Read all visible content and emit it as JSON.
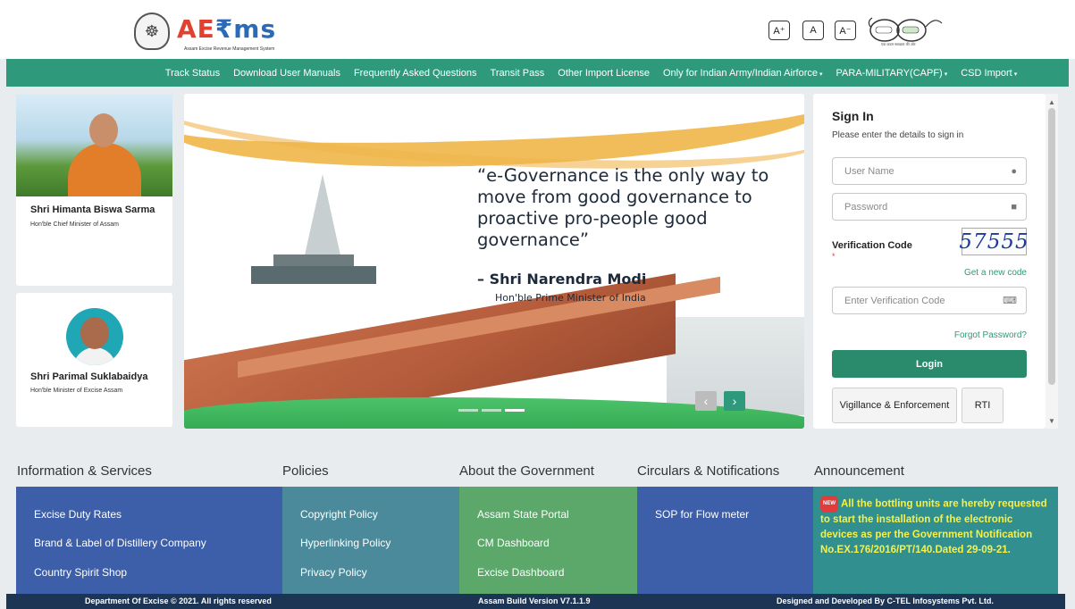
{
  "header": {
    "logo_main": "AE",
    "logo_accent": "₹ms",
    "logo_sub": "Assam Excise Revenue Management System",
    "font_buttons": [
      "A⁺",
      "A",
      "A⁻"
    ],
    "swachh_text": "एक कदम स्वच्छता की ओर"
  },
  "nav": {
    "items": [
      {
        "label": "Track Status"
      },
      {
        "label": "Download User Manuals"
      },
      {
        "label": "Frequently Asked Questions"
      },
      {
        "label": "Transit Pass"
      },
      {
        "label": "Other Import License"
      },
      {
        "label": "Only for Indian Army/Indian Airforce",
        "dropdown": true
      },
      {
        "label": "PARA-MILITARY(CAPF)",
        "dropdown": true
      },
      {
        "label": "CSD Import",
        "dropdown": true
      }
    ],
    "caret": "▾"
  },
  "profiles": [
    {
      "name": "Shri Himanta Biswa Sarma",
      "role": "Hon'ble Chief Minister of Assam"
    },
    {
      "name": "Shri Parimal Suklabaidya",
      "role": "Hon'ble Minister of Excise Assam"
    }
  ],
  "banner": {
    "quote": "“e-Governance is the only way to move from good governance to proactive pro-people good governance”",
    "author": "– Shri Narendra Modi",
    "author_role": "Hon'ble Prime Minister of India",
    "prev": "‹",
    "next": "›"
  },
  "signin": {
    "title": "Sign In",
    "subtitle": "Please enter the details to sign in",
    "username_placeholder": "User Name",
    "password_placeholder": "Password",
    "verification_label": "Verification Code",
    "required_mark": "*",
    "captcha": "57555",
    "new_code": "Get a new code",
    "code_placeholder": "Enter Verification Code",
    "forgot": "Forgot Password?",
    "login": "Login",
    "vigilance": "Vigillance & Enforcement",
    "rti": "RTI"
  },
  "sections": {
    "info": {
      "title": "Information & Services",
      "items": [
        "Excise Duty Rates",
        "Brand & Label of Distillery Company",
        "Country Spirit Shop"
      ],
      "color": "#3d5ea8"
    },
    "policies": {
      "title": "Policies",
      "items": [
        "Copyright Policy",
        "Hyperlinking Policy",
        "Privacy Policy"
      ],
      "color": "#4b8a9a"
    },
    "govt": {
      "title": "About the Government",
      "items": [
        "Assam State Portal",
        "CM Dashboard",
        "Excise Dashboard"
      ],
      "color": "#5ba86a"
    },
    "circulars": {
      "title": "Circulars & Notifications",
      "items": [
        "SOP for Flow meter"
      ],
      "color": "#3d5ea8"
    },
    "announcement": {
      "title": "Announcement",
      "badge": "NEW",
      "text": "All the bottling units are hereby requested to start the installation of the electronic devices as per the Government Notification No.EX.176/2016/PT/140.Dated 29-09-21."
    }
  },
  "footer": {
    "copyright": "Department Of Excise © 2021. All rights reserved",
    "version": "Assam Build Version V7.1.1.9",
    "credits": "Designed and Developed By C-TEL Infosystems Pvt. Ltd."
  },
  "colors": {
    "nav": "#2e9a7b",
    "login": "#2a8a6c",
    "footer": "#1c3554",
    "announcement_text": "#f7f04a"
  }
}
